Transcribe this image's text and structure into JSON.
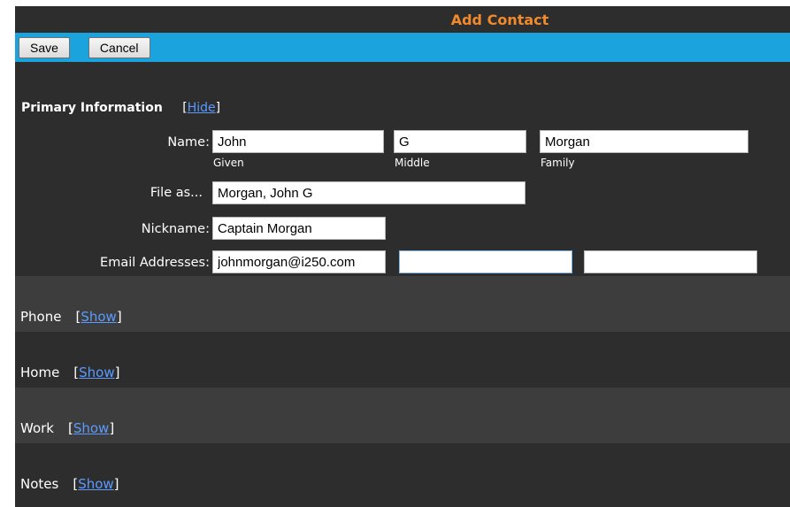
{
  "title": "Add Contact",
  "toolbar": {
    "save_label": "Save",
    "cancel_label": "Cancel"
  },
  "primary": {
    "heading": "Primary Information",
    "toggle_open": "[",
    "toggle_text": "Hide",
    "toggle_close": "]",
    "name_label": "Name:",
    "given_value": "John",
    "middle_value": "G",
    "family_value": "Morgan",
    "given_caption": "Given",
    "middle_caption": "Middle",
    "family_caption": "Family",
    "file_as_label": "File as...",
    "file_as_value": "Morgan, John G",
    "nickname_label": "Nickname:",
    "nickname_value": "Captain Morgan",
    "email_label": "Email Addresses:",
    "email_1": "johnmorgan@i250.com",
    "email_2": "",
    "email_3": ""
  },
  "sections": [
    {
      "label": "Phone",
      "toggle": "Show"
    },
    {
      "label": "Home",
      "toggle": "Show"
    },
    {
      "label": "Work",
      "toggle": "Show"
    },
    {
      "label": "Notes",
      "toggle": "Show"
    }
  ],
  "bracket_open": "[",
  "bracket_close": "]",
  "colors": {
    "title": "#f08a2c",
    "toolbar": "#1aa3dc",
    "link": "#5b9bff",
    "panel_dark": "#2d2d2d",
    "panel_light": "#3d3d3d"
  }
}
